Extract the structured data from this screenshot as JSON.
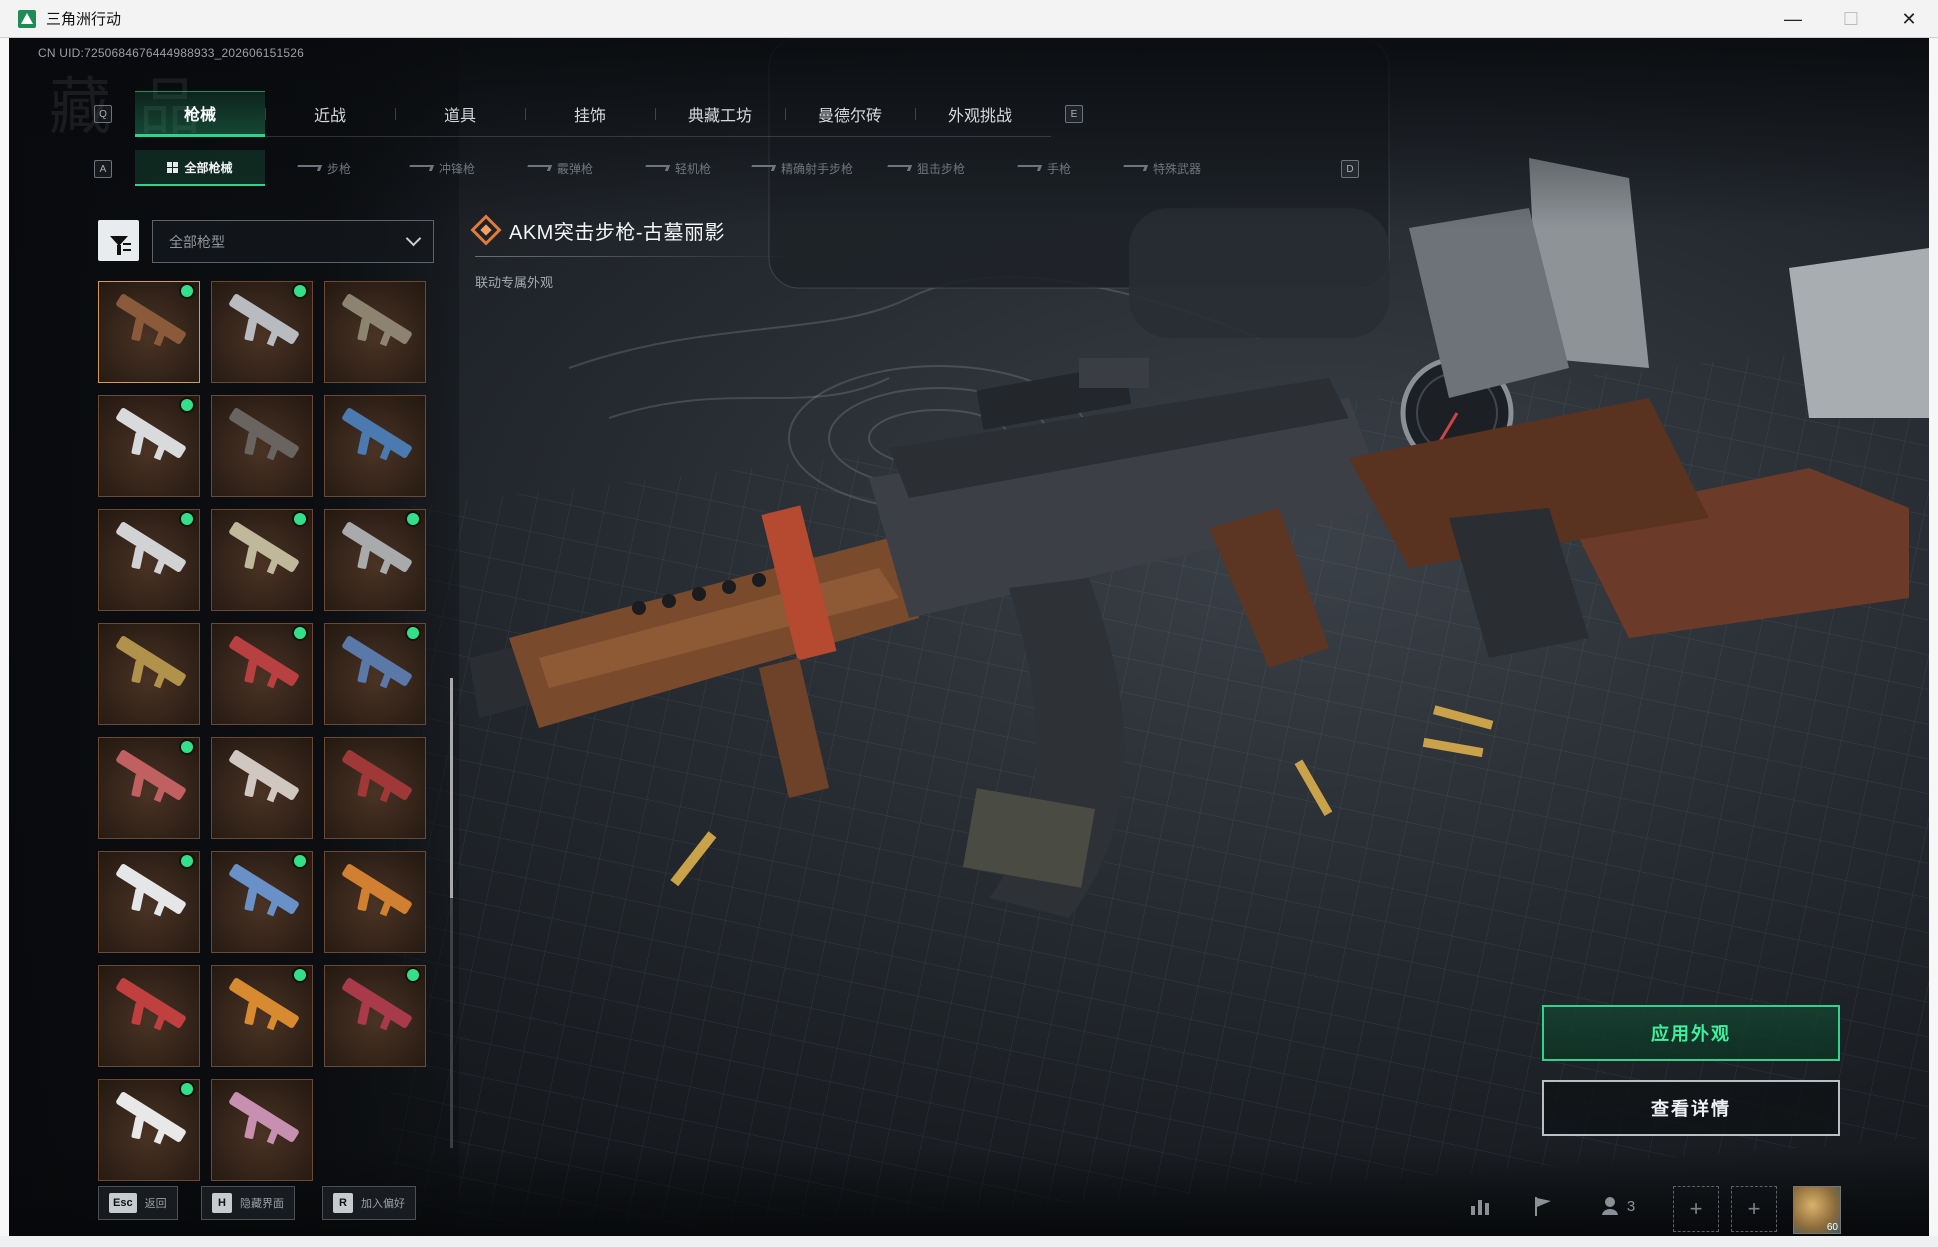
{
  "window": {
    "title": "三角洲行动",
    "minimize": "—",
    "maximize": "☐",
    "close": "✕"
  },
  "uid": "CN UID:7250684676444988933_202606151526",
  "watermark": "藏 品",
  "main_tabs": {
    "left_key": "Q",
    "right_key": "E",
    "items": [
      {
        "label": "枪械",
        "active": true
      },
      {
        "label": "近战",
        "active": false
      },
      {
        "label": "道具",
        "active": false
      },
      {
        "label": "挂饰",
        "active": false
      },
      {
        "label": "典藏工坊",
        "active": false
      },
      {
        "label": "曼德尔砖",
        "active": false
      },
      {
        "label": "外观挑战",
        "active": false
      }
    ]
  },
  "sub_tabs": {
    "left_key": "A",
    "right_key": "D",
    "items": [
      {
        "label": "全部枪械",
        "active": true
      },
      {
        "label": "步枪",
        "active": false
      },
      {
        "label": "冲锋枪",
        "active": false
      },
      {
        "label": "霰弹枪",
        "active": false
      },
      {
        "label": "轻机枪",
        "active": false
      },
      {
        "label": "精确射手步枪",
        "active": false
      },
      {
        "label": "狙击步枪",
        "active": false
      },
      {
        "label": "手枪",
        "active": false
      },
      {
        "label": "特殊武器",
        "active": false
      }
    ]
  },
  "filter": {
    "icon": "filter-funnel-icon",
    "select_value": "全部枪型"
  },
  "skins": [
    {
      "owned": true,
      "tone": "#8a5a3a",
      "selected": true
    },
    {
      "owned": true,
      "tone": "#b8bcc0",
      "selected": false
    },
    {
      "owned": false,
      "tone": "#8c8470",
      "selected": false
    },
    {
      "owned": true,
      "tone": "#d8dadc",
      "selected": false
    },
    {
      "owned": false,
      "tone": "#6a6460",
      "selected": false
    },
    {
      "owned": false,
      "tone": "#4a7ab0",
      "selected": false
    },
    {
      "owned": true,
      "tone": "#d0d2d4",
      "selected": false
    },
    {
      "owned": true,
      "tone": "#c0b89a",
      "selected": false
    },
    {
      "owned": true,
      "tone": "#a8aaac",
      "selected": false
    },
    {
      "owned": false,
      "tone": "#b0924a",
      "selected": false
    },
    {
      "owned": true,
      "tone": "#b84040",
      "selected": false
    },
    {
      "owned": true,
      "tone": "#5a78a8",
      "selected": false
    },
    {
      "owned": true,
      "tone": "#c06060",
      "selected": false
    },
    {
      "owned": false,
      "tone": "#d0c8c0",
      "selected": false
    },
    {
      "owned": false,
      "tone": "#a03838",
      "selected": false
    },
    {
      "owned": true,
      "tone": "#e4e6e8",
      "selected": false
    },
    {
      "owned": true,
      "tone": "#6a90c8",
      "selected": false
    },
    {
      "owned": false,
      "tone": "#d08030",
      "selected": false
    },
    {
      "owned": false,
      "tone": "#c04040",
      "selected": false
    },
    {
      "owned": true,
      "tone": "#d88a30",
      "selected": false
    },
    {
      "owned": true,
      "tone": "#a83a4a",
      "selected": false
    },
    {
      "owned": true,
      "tone": "#e8e8e8",
      "selected": false
    },
    {
      "owned": false,
      "tone": "#c890b0",
      "selected": false
    }
  ],
  "selected_skin": {
    "icon": "rarity-diamond-icon",
    "name": "AKM突击步枪-古墓丽影",
    "subtitle": "联动专属外观"
  },
  "actions": {
    "apply": "应用外观",
    "details": "查看详情"
  },
  "hotkeys": [
    {
      "key": "Esc",
      "label": "返回"
    },
    {
      "key": "H",
      "label": "隐藏界面"
    },
    {
      "key": "R",
      "label": "加入偏好"
    }
  ],
  "tray": {
    "stats_icon": "bar-chart-icon",
    "flag_icon": "flag-icon",
    "party_icon": "party-icon",
    "party_count": "3",
    "slot_plus": "+",
    "avatar_level": "60"
  },
  "colors": {
    "accent": "#2fd38c",
    "apply_text": "#3ff09d",
    "rarity": "#e07b3a",
    "owned_dot": "#33e08a"
  }
}
